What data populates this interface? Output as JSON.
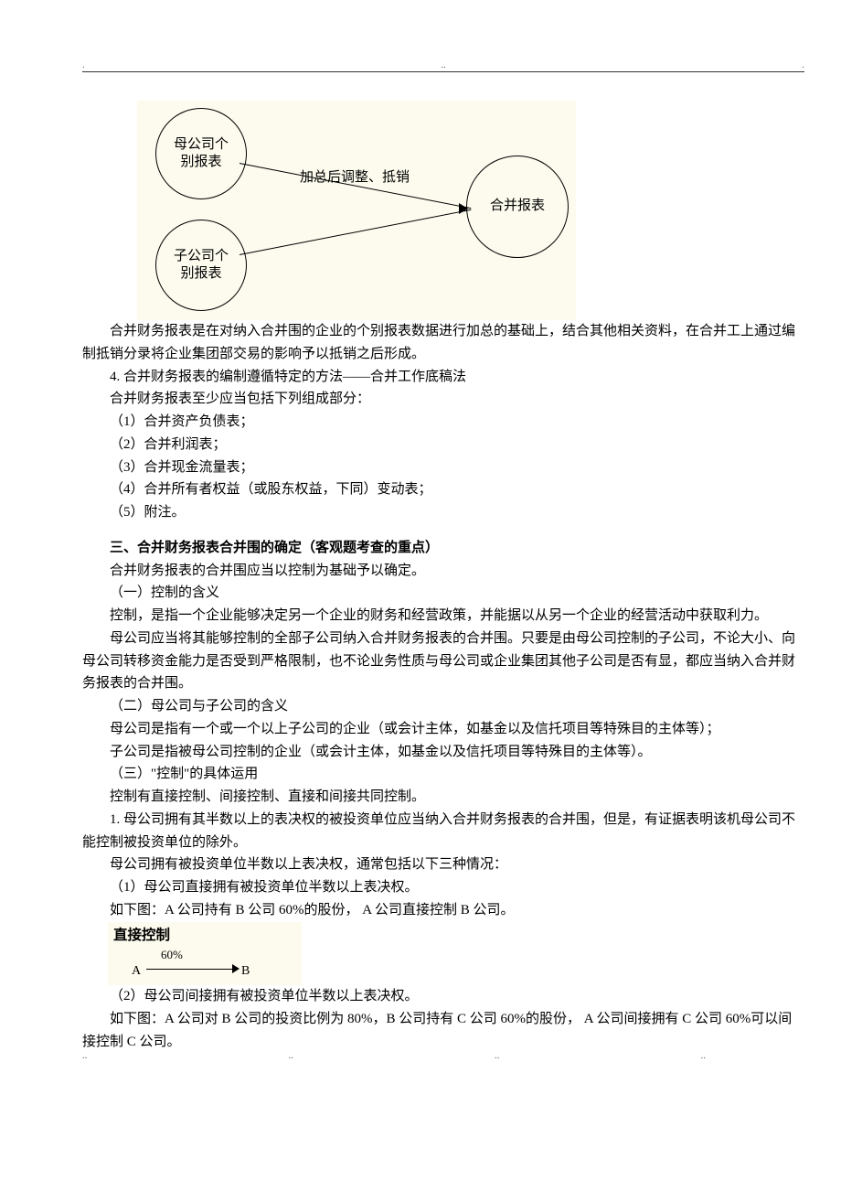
{
  "header_dots": {
    "left": ".",
    "mid": "..",
    "right": "."
  },
  "footer_dots": {
    "a": "..",
    "b": "..",
    "c": "..",
    "d": ".."
  },
  "diagram": {
    "node1": "母公司个\n别报表",
    "node2": "子公司个\n别报表",
    "node3": "合并报表",
    "arrow_label": "加总后调整、抵销"
  },
  "body": {
    "p_intro": "合并财务报表是在对纳入合并围的企业的个别报表数据进行加总的基础上，结合其他相关资料，在合并工上通过编制抵销分录将企业集团部交易的影响予以抵销之后形成。",
    "p4": "4. 合并财务报表的编制遵循特定的方法——合并工作底稿法",
    "p_comp": "合并财务报表至少应当包括下列组成部分：",
    "li1": "（1）合并资产负债表；",
    "li2": "（2）合并利润表；",
    "li3": "（3）合并现金流量表；",
    "li4": "（4）合并所有者权益（或股东权益，下同）变动表；",
    "li5": "（5）附注。",
    "h3": "三、合并财务报表合并围的确定（客观题考查的重点）",
    "p_scope": "合并财务报表的合并围应当以控制为基础予以确定。",
    "s1": "（一）控制的含义",
    "p_ctrl": "控制，是指一个企业能够决定另一个企业的财务和经营政策，并能据以从另一个企业的经营活动中获取利力。",
    "p_parent_scope": "母公司应当将其能够控制的全部子公司纳入合并财务报表的合并围。只要是由母公司控制的子公司，不论大小、向母公司转移资金能力是否受到严格限制，也不论业务性质与母公司或企业集团其他子公司是否有显，都应当纳入合并财务报表的合并围。",
    "s2": "（二）母公司与子公司的含义",
    "p_parent": "母公司是指有一个或一个以上子公司的企业（或会计主体，如基金以及信托项目等特殊目的主体等）；",
    "p_sub": "子公司是指被母公司控制的企业（或会计主体，如基金以及信托项目等特殊目的主体等）。",
    "s3": "（三）\"控制\"的具体运用",
    "p_types": "控制有直接控制、间接控制、直接和间接共同控制。",
    "p_rule1": "1. 母公司拥有其半数以上的表决权的被投资单位应当纳入合并财务报表的合并围，但是，有证据表明该机母公司不能控制被投资单位的除外。",
    "p_half": "母公司拥有被投资单位半数以上表决权，通常包括以下三种情况：",
    "case1": "（1）母公司直接拥有被投资单位半数以上表决权。",
    "case1_fig": "如下图：A 公司持有 B 公司 60%的股份， A 公司直接控制 B 公司。",
    "direct_title": "直接控制",
    "direct_pct": "60%",
    "direct_a": "A",
    "direct_b": "B",
    "case2": "（2）母公司间接拥有被投资单位半数以上表决权。",
    "case2_fig": "如下图：A 公司对 B 公司的投资比例为 80%，B 公司持有 C 公司 60%的股份， A 公司间接拥有 C 公司 60%可以间接控制 C 公司。"
  }
}
